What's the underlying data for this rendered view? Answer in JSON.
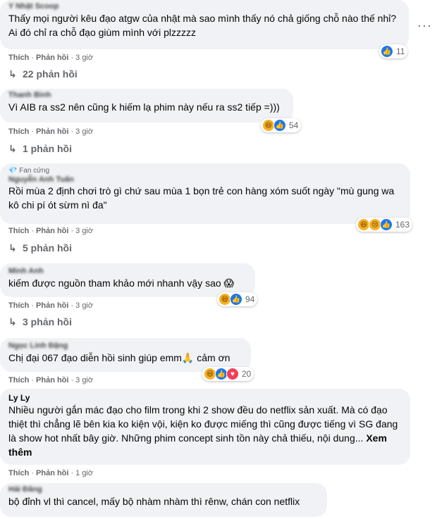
{
  "actions": {
    "like": "Thích",
    "reply": "Phản hồi",
    "sep": "·"
  },
  "menu": "···",
  "comments": [
    {
      "author": "Y Nhật Scoop",
      "text": "Thấy mọi người kêu đạo atgw của nhật mà sao mình thấy nó chả giống chỗ nào thế nhỉ? Ai đó chỉ ra chỗ đạo giùm mình với plzzzzz",
      "time": "3 giờ",
      "reactions": "11",
      "replies": "22 phản hồi"
    },
    {
      "author": "Thanh Bình",
      "text": "Vì AIB ra ss2 nên cũng k hiếm lạ phim này nếu ra ss2 tiếp =)))",
      "time": "3 giờ",
      "reactions": "54",
      "replies": "1 phản hồi"
    },
    {
      "badge": "Fan cứng",
      "author": "Nguyễn Anh Tuấn",
      "text": "Rồi mùa 2 định chơi trò gì chứ sau mùa 1 bọn trẻ con hàng xóm suốt ngày \"mù gung wa kô chi pí ót sừm nì đa\"",
      "time": "3 giờ",
      "reactions": "163",
      "replies": "5 phản hồi"
    },
    {
      "author": "Minh Anh",
      "text": "kiếm được nguồn tham khảo mới nhanh vậy sao 😱",
      "time": "3 giờ",
      "reactions": "94",
      "replies": "3 phản hồi"
    },
    {
      "author": "Ngọc Linh Đặng",
      "text": "Chị đại 067 đạo diễn hồi sinh giúp emm🙏 cảm ơn",
      "time": "3 giờ",
      "reactions": "20"
    },
    {
      "author": "Ly Ly",
      "text": "Nhiều người gắn mác đạo cho film trong khi 2 show đều do netflix sản xuất. Mà có đạo thiệt thì chẳng lẽ bên kia ko kiện vội, kiện ko được miếng thì cũng được tiếng vì SG đang là show hot nhất bây giờ. Những phim concept sinh tồn này chả thiếu, nội dung...",
      "see_more": "Xem thêm",
      "time": "1 giờ"
    },
    {
      "author": "Hải Đăng",
      "text": "bộ đỉnh vl thì cancel, mấy bộ nhàm nhàm thì rênw, chán con netflix"
    }
  ]
}
